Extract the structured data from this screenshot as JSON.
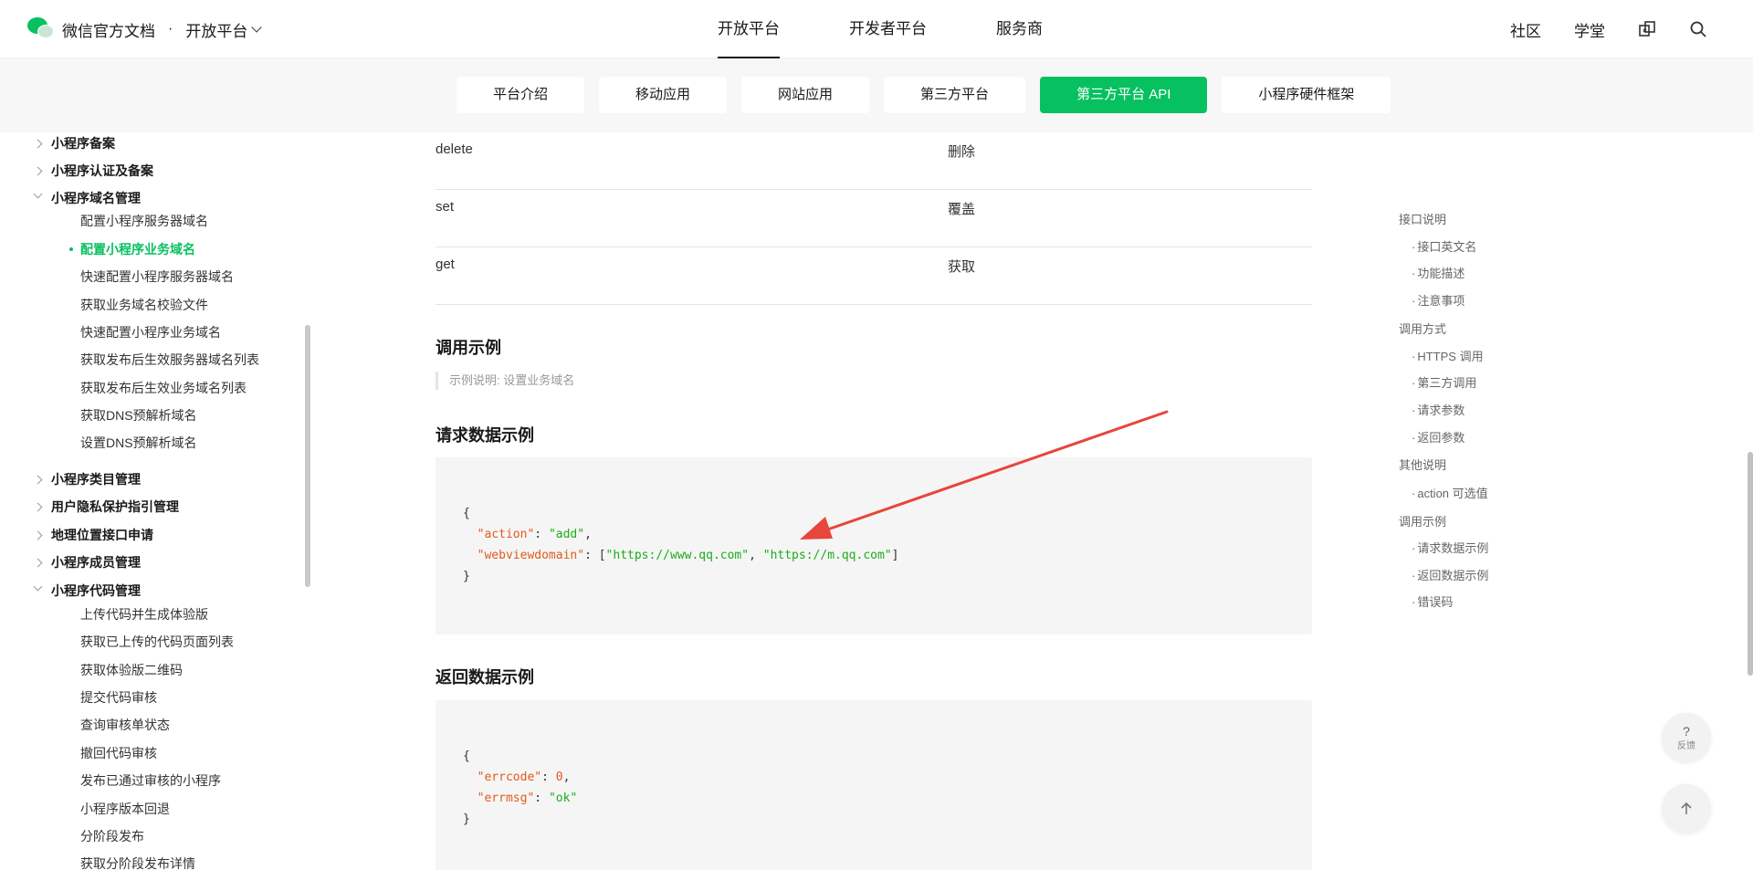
{
  "header": {
    "brand_title": "微信官方文档",
    "brand_dot": "·",
    "platform_label": "开放平台",
    "nav": [
      "开放平台",
      "开发者平台",
      "服务商"
    ],
    "right": [
      "社区",
      "学堂"
    ]
  },
  "subnav": {
    "items": [
      "平台介绍",
      "移动应用",
      "网站应用",
      "第三方平台",
      "第三方平台 API",
      "小程序硬件框架"
    ],
    "active_index": 4,
    "accent": "#07c160"
  },
  "sidebar": {
    "groups_top": [
      "小程序备案",
      "小程序认证及备案",
      "小程序域名管理"
    ],
    "domain_items": [
      "配置小程序服务器域名",
      "配置小程序业务域名",
      "快速配置小程序服务器域名",
      "获取业务域名校验文件",
      "快速配置小程序业务域名",
      "获取发布后生效服务器域名列表",
      "获取发布后生效业务域名列表",
      "获取DNS预解析域名",
      "设置DNS预解析域名"
    ],
    "active_item": "配置小程序业务域名",
    "groups_mid": [
      "小程序类目管理",
      "用户隐私保护指引管理",
      "地理位置接口申请",
      "小程序成员管理",
      "小程序代码管理"
    ],
    "code_items": [
      "上传代码并生成体验版",
      "获取已上传的代码页面列表",
      "获取体验版二维码",
      "提交代码审核",
      "查询审核单状态",
      "撤回代码审核",
      "发布已通过审核的小程序",
      "小程序版本回退",
      "分阶段发布",
      "获取分阶段发布详情"
    ]
  },
  "main": {
    "rows": [
      {
        "k": "delete",
        "v": "删除"
      },
      {
        "k": "set",
        "v": "覆盖"
      },
      {
        "k": "get",
        "v": "获取"
      }
    ],
    "section_title": "调用示例",
    "example_note": "示例说明: 设置业务域名",
    "request_title": "请求数据示例",
    "request_code": {
      "open": "{",
      "k1": "\"action\"",
      "v1": "\"add\"",
      "k2": "\"webviewdomain\"",
      "v2a": "\"https://www.qq.com\"",
      "v2b": "\"https://m.qq.com\"",
      "close": "}"
    },
    "response_title": "返回数据示例",
    "response_code": {
      "open": "{",
      "k1": "\"errcode\"",
      "v1": "0",
      "k2": "\"errmsg\"",
      "v2": "\"ok\"",
      "close": "}"
    }
  },
  "toc": {
    "items": [
      {
        "label": "接口说明",
        "sub": false
      },
      {
        "label": "接口英文名",
        "sub": true
      },
      {
        "label": "功能描述",
        "sub": true
      },
      {
        "label": "注意事项",
        "sub": true
      },
      {
        "label": "调用方式",
        "sub": false
      },
      {
        "label": "HTTPS 调用",
        "sub": true
      },
      {
        "label": "第三方调用",
        "sub": true
      },
      {
        "label": "请求参数",
        "sub": true
      },
      {
        "label": "返回参数",
        "sub": true
      },
      {
        "label": "其他说明",
        "sub": false
      },
      {
        "label": "action 可选值",
        "sub": true
      },
      {
        "label": "调用示例",
        "sub": false
      },
      {
        "label": "请求数据示例",
        "sub": true
      },
      {
        "label": "返回数据示例",
        "sub": true
      },
      {
        "label": "错误码",
        "sub": true
      }
    ]
  },
  "float": {
    "feedback_q": "?",
    "feedback_label": "反馈"
  },
  "annotation_color": "#e8453c",
  "icons": [
    "wechat-logo-icon",
    "chevron-down-icon",
    "compare-icon",
    "search-icon",
    "arrow-up-icon",
    "red-arrow-annotation-icon"
  ]
}
